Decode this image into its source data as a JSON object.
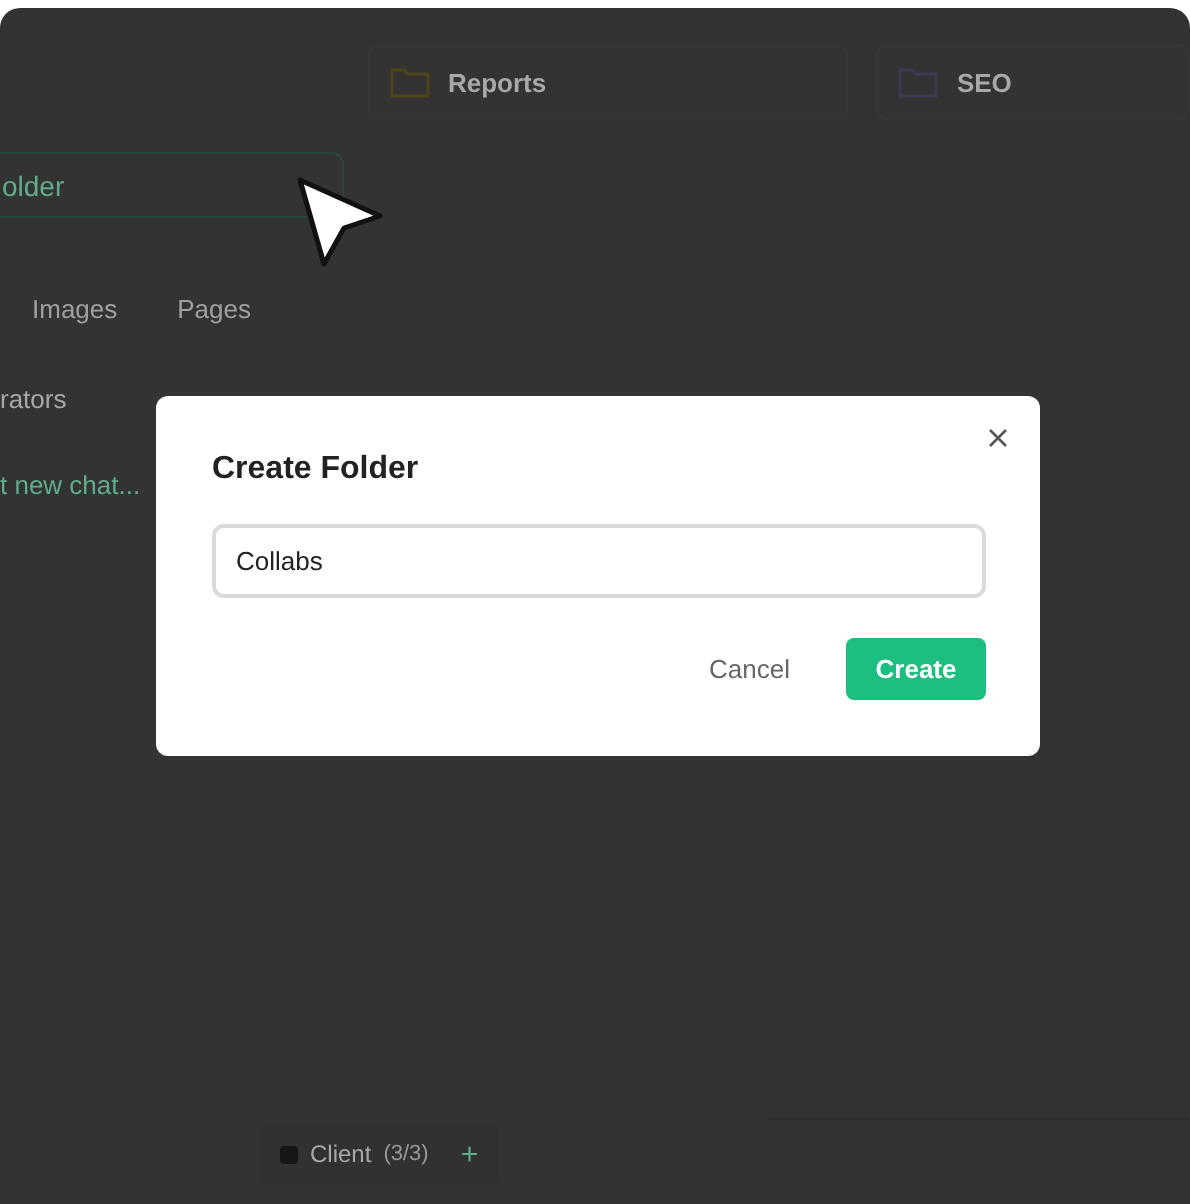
{
  "folders": [
    {
      "name": "Reports",
      "color": "#4d4418"
    },
    {
      "name": "SEO",
      "color": "#3c3a52"
    }
  ],
  "new_folder_button": {
    "label": "older"
  },
  "tabs": [
    {
      "label": "Images",
      "selected": false
    },
    {
      "label": "Pages",
      "selected": false
    }
  ],
  "list": [
    {
      "label": "rators",
      "kind": "item"
    },
    {
      "label": "t new chat...",
      "kind": "action"
    }
  ],
  "bottom_tab": {
    "label": "Client",
    "count": "(3/3)",
    "add": "+"
  },
  "dialog": {
    "title": "Create Folder",
    "value": "Collabs",
    "cancel": "Cancel",
    "create": "Create"
  }
}
